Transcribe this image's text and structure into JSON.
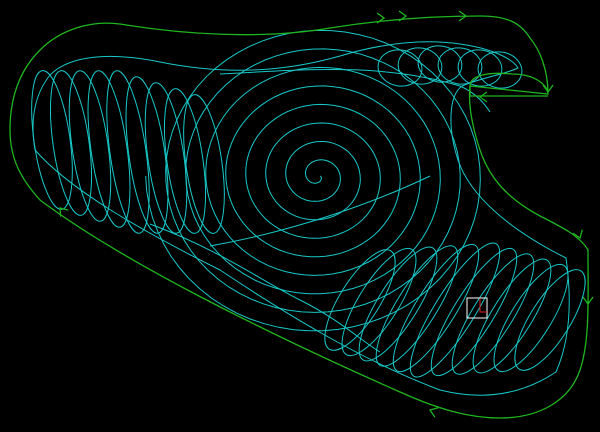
{
  "viewport": {
    "background": "#000000"
  },
  "colors": {
    "outer_contour": "#1fb51f",
    "direction_arrows": "#1fb51f",
    "pocket_toolpath": "#19c8c8",
    "cursor": "#ffffff",
    "cursor_accent": "#e02020"
  },
  "toolpath": {
    "strategy_shapes": [
      "outer-contour",
      "spiral-center",
      "left-loops",
      "top-right-loops",
      "bottom-right-loops"
    ],
    "spiral_turns": 8.5,
    "left_loop_count": 9,
    "top_loop_count": 6,
    "bottom_loop_count": 11,
    "arrow_count": 9
  },
  "icons": {
    "cursor": "pick-box-cursor-icon"
  }
}
